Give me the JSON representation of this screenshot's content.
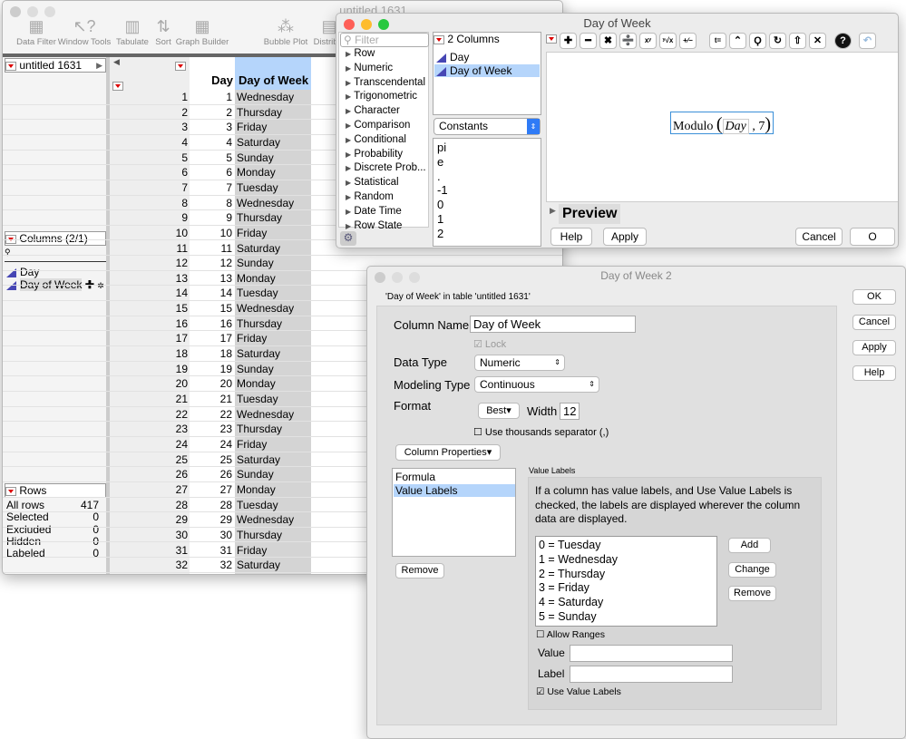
{
  "main_window": {
    "title": "untitled 1631",
    "toolbar": [
      {
        "label": "Data Filter",
        "icon": "data-filter-icon"
      },
      {
        "label": "Window Tools",
        "icon": "window-tools-icon"
      },
      {
        "label": "Tabulate",
        "icon": "tabulate-icon"
      },
      {
        "label": "Sort",
        "icon": "sort-icon"
      },
      {
        "label": "Graph Builder",
        "icon": "graph-builder-icon"
      },
      {
        "label": "Bubble Plot",
        "icon": "bubble-plot-icon"
      },
      {
        "label": "Distribut",
        "icon": "distribution-icon"
      }
    ],
    "table_panel": "untitled 1631",
    "columns_panel": {
      "title": "Columns (2/1)",
      "items": [
        "Day",
        "Day of Week"
      ]
    },
    "rows_panel": {
      "title": "Rows",
      "items": [
        {
          "label": "All rows",
          "value": "417"
        },
        {
          "label": "Selected",
          "value": "0"
        },
        {
          "label": "Excluded",
          "value": "0"
        },
        {
          "label": "Hidden",
          "value": "0"
        },
        {
          "label": "Labeled",
          "value": "0"
        }
      ]
    },
    "table": {
      "headers": [
        "Day",
        "Day of Week"
      ],
      "rows": [
        [
          1,
          "Wednesday"
        ],
        [
          2,
          "Thursday"
        ],
        [
          3,
          "Friday"
        ],
        [
          4,
          "Saturday"
        ],
        [
          5,
          "Sunday"
        ],
        [
          6,
          "Monday"
        ],
        [
          7,
          "Tuesday"
        ],
        [
          8,
          "Wednesday"
        ],
        [
          9,
          "Thursday"
        ],
        [
          10,
          "Friday"
        ],
        [
          11,
          "Saturday"
        ],
        [
          12,
          "Sunday"
        ],
        [
          13,
          "Monday"
        ],
        [
          14,
          "Tuesday"
        ],
        [
          15,
          "Wednesday"
        ],
        [
          16,
          "Thursday"
        ],
        [
          17,
          "Friday"
        ],
        [
          18,
          "Saturday"
        ],
        [
          19,
          "Sunday"
        ],
        [
          20,
          "Monday"
        ],
        [
          21,
          "Tuesday"
        ],
        [
          22,
          "Wednesday"
        ],
        [
          23,
          "Thursday"
        ],
        [
          24,
          "Friday"
        ],
        [
          25,
          "Saturday"
        ],
        [
          26,
          "Sunday"
        ],
        [
          27,
          "Monday"
        ],
        [
          28,
          "Tuesday"
        ],
        [
          29,
          "Wednesday"
        ],
        [
          30,
          "Thursday"
        ],
        [
          31,
          "Friday"
        ],
        [
          32,
          "Saturday"
        ]
      ]
    }
  },
  "formula_window": {
    "title": "Day of Week",
    "filter_placeholder": "Filter",
    "functions": [
      "Row",
      "Numeric",
      "Transcendental",
      "Trigonometric",
      "Character",
      "Comparison",
      "Conditional",
      "Probability",
      "Discrete Prob...",
      "Statistical",
      "Random",
      "Date Time",
      "Row State"
    ],
    "columns_title": "2 Columns",
    "columns": [
      "Day",
      "Day of Week"
    ],
    "constants_select": "Constants",
    "constants": [
      "pi",
      "e",
      ".",
      "-1",
      "0",
      "1",
      "2"
    ],
    "formula": {
      "fn": "Modulo",
      "arg1": "Day",
      "arg2": "7"
    },
    "preview": "Preview",
    "buttons": {
      "help": "Help",
      "apply": "Apply",
      "cancel": "Cancel",
      "ok": "O"
    }
  },
  "column_dialog": {
    "title": "Day of Week 2",
    "subtitle": "'Day of Week' in table 'untitled 1631'",
    "column_name_label": "Column Name",
    "column_name": "Day of Week",
    "lock": "Lock",
    "data_type_label": "Data Type",
    "data_type": "Numeric",
    "modeling_type_label": "Modeling Type",
    "modeling_type": "Continuous",
    "format_label": "Format",
    "format": "Best",
    "width_label": "Width",
    "width": "12",
    "thousands": "Use thousands separator (,)",
    "column_properties": "Column Properties",
    "properties": [
      "Formula",
      "Value Labels"
    ],
    "remove": "Remove",
    "value_labels": {
      "title": "Value Labels",
      "description": "If a column has value labels, and Use Value Labels is checked, the labels are displayed wherever the column data are displayed.",
      "items": [
        "0 = Tuesday",
        "1 = Wednesday",
        "2 = Thursday",
        "3 = Friday",
        "4 = Saturday",
        "5 = Sunday"
      ],
      "add": "Add",
      "change": "Change",
      "remove": "Remove",
      "allow_ranges": "Allow Ranges",
      "value_label": "Value",
      "label_label": "Label",
      "use_value_labels": "Use Value Labels"
    },
    "buttons": {
      "ok": "OK",
      "cancel": "Cancel",
      "apply": "Apply",
      "help": "Help"
    }
  }
}
